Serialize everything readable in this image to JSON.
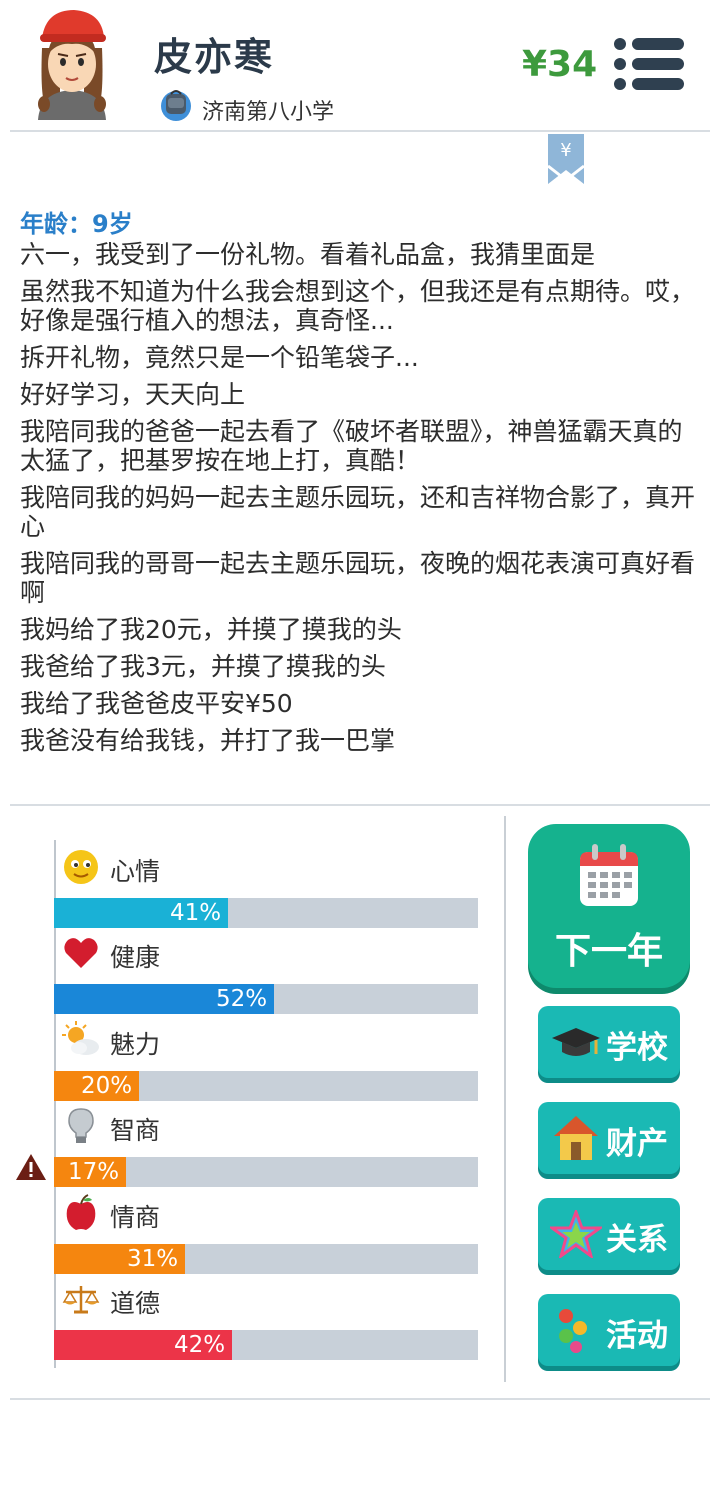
{
  "header": {
    "name": "皮亦寒",
    "school": "济南第八小学",
    "money": "¥34"
  },
  "ribbon": {
    "symbol": "¥"
  },
  "story": {
    "age": "年龄：9岁",
    "lines": [
      "六一，我受到了一份礼物。看着礼品盒，我猜里面是",
      "虽然我不知道为什么我会想到这个，但我还是有点期待。哎，好像是强行植入的想法，真奇怪...",
      "拆开礼物，竟然只是一个铅笔袋子...",
      "好好学习，天天向上",
      "我陪同我的爸爸一起去看了《破坏者联盟》，神兽猛霸天真的太猛了，把基罗按在地上打，真酷！",
      "我陪同我的妈妈一起去主题乐园玩，还和吉祥物合影了，真开心",
      "我陪同我的哥哥一起去主题乐园玩，夜晚的烟花表演可真好看啊",
      "我妈给了我20元，并摸了摸我的头",
      "我爸给了我3元，并摸了摸我的头",
      "我给了我爸爸皮平安¥50",
      "我爸没有给我钱，并打了我一巴掌"
    ]
  },
  "stats": [
    {
      "label": "心情",
      "pct": "41%",
      "value": 41,
      "color": "#1ab1d6",
      "icon": "smiley-icon"
    },
    {
      "label": "健康",
      "pct": "52%",
      "value": 52,
      "color": "#1a87d8",
      "icon": "heart-icon"
    },
    {
      "label": "魅力",
      "pct": "20%",
      "value": 20,
      "color": "#f5860f",
      "icon": "sun-cloud-icon"
    },
    {
      "label": "智商",
      "pct": "17%",
      "value": 17,
      "color": "#f5860f",
      "icon": "lightbulb-icon"
    },
    {
      "label": "情商",
      "pct": "31%",
      "value": 31,
      "color": "#f5860f",
      "icon": "apple-icon"
    },
    {
      "label": "道德",
      "pct": "42%",
      "value": 42,
      "color": "#ec3448",
      "icon": "scales-icon"
    }
  ],
  "warning": {
    "icon": "warning-icon"
  },
  "actions": {
    "next_year": "下一年",
    "school": "学校",
    "property": "财产",
    "relations": "关系",
    "activities": "活动"
  }
}
